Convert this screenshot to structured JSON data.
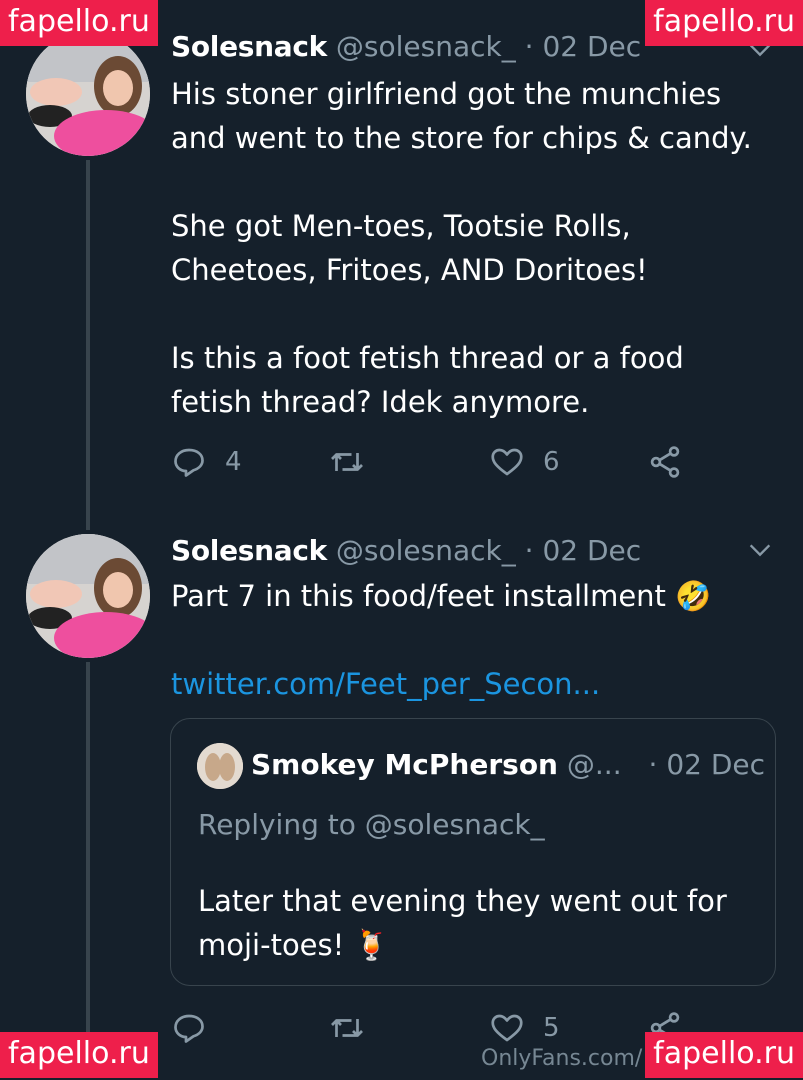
{
  "watermark": "fapello.ru",
  "footer_watermark": "OnlyFans.com/",
  "colors": {
    "background": "#15202b",
    "link": "#1b95e0",
    "muted": "#8899a6",
    "watermark_bg": "#ee1f4b"
  },
  "tweet1": {
    "name": "Solesnack",
    "handle": "@solesnack_",
    "dot": "·",
    "date": "02 Dec",
    "paragraphs": [
      "His stoner girlfriend got the munchies and went to the store for chips & candy.",
      "She got Men-toes, Tootsie Rolls, Cheetoes, Fritoes, AND Doritoes!",
      "Is this a foot fetish thread or a food fetish thread? Idek anymore."
    ],
    "reply_count": "4",
    "retweet_count": "",
    "like_count": "6"
  },
  "tweet2": {
    "name": "Solesnack",
    "handle": "@solesnack_",
    "dot": "·",
    "date": "02 Dec",
    "text": "Part 7 in this food/feet installment 🤣",
    "link": "twitter.com/Feet_per_Secon...",
    "quote": {
      "name": "Smokey McPherson",
      "handle": "@...",
      "dot": "·",
      "date": "02 Dec",
      "replying": "Replying to @solesnack_",
      "text": "Later that evening they went out for moji-toes! 🍹"
    },
    "reply_count": "",
    "retweet_count": "",
    "like_count": "5"
  },
  "icons": [
    "reply-icon",
    "retweet-icon",
    "like-icon",
    "share-icon",
    "chevron-down-icon"
  ]
}
